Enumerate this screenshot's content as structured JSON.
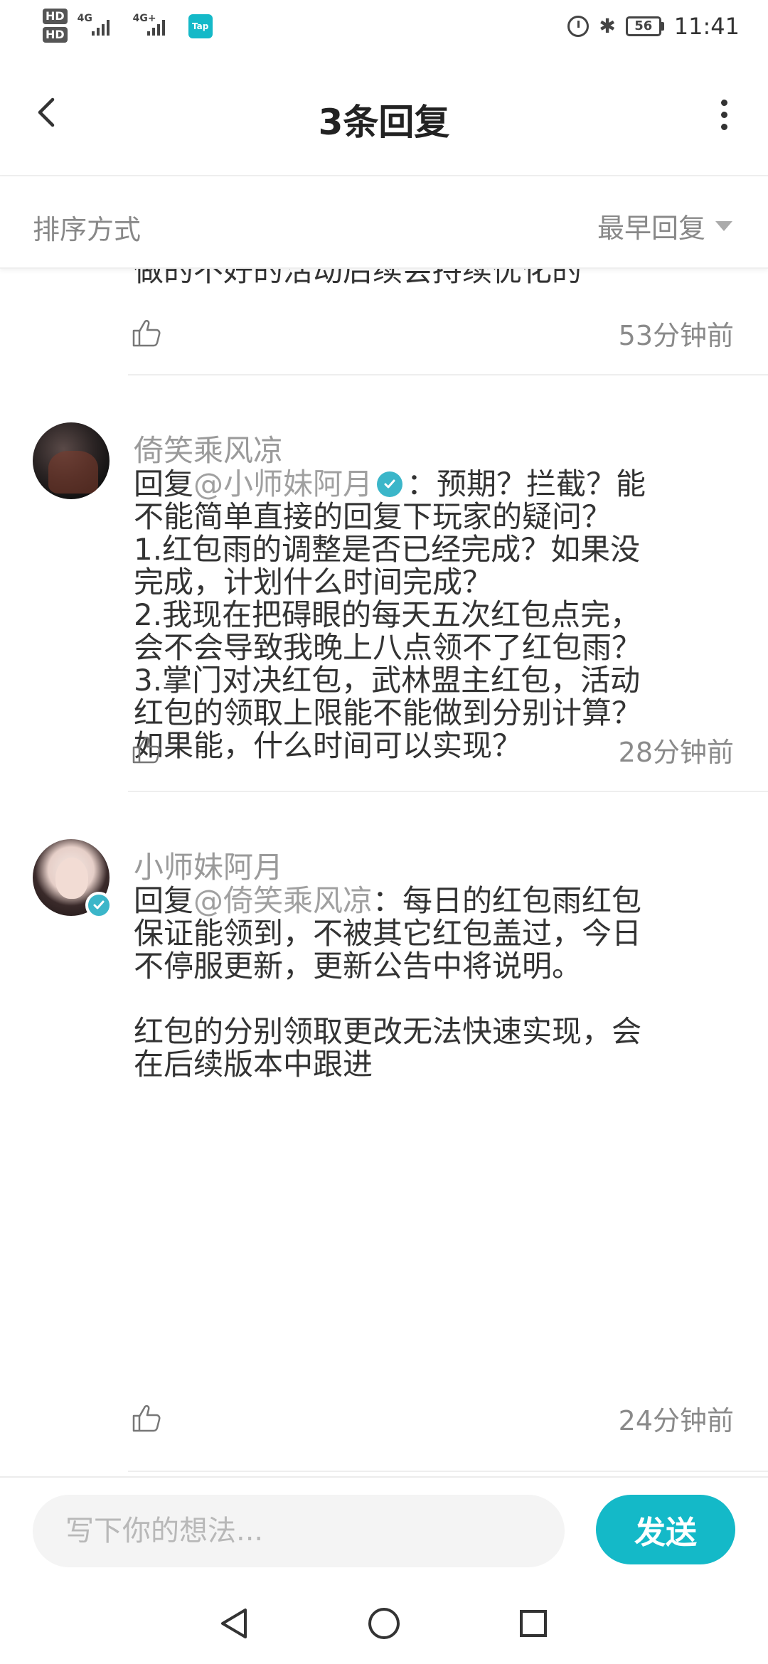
{
  "status_bar": {
    "hd1": "HD",
    "hd2": "HD",
    "net1": "4G",
    "net2": "4G+",
    "app_badge": "Tap",
    "battery": "56",
    "time": "11:41"
  },
  "header": {
    "title": "3条回复"
  },
  "sort": {
    "label": "排序方式",
    "value": "最早回复"
  },
  "partial_comment": {
    "text": "做的不好的活动后续会持续优化的",
    "time": "53分钟前"
  },
  "comments": [
    {
      "username": "倚笑乘风凉",
      "reply_prefix": "回复",
      "mention": "@小师妹阿月",
      "mention_verified": true,
      "lines": [
        "：预期？拦截？能",
        "不能简单直接的回复下玩家的疑问？",
        "1.红包雨的调整是否已经完成？如果没",
        "完成，计划什么时间完成？",
        "2.我现在把碍眼的每天五次红包点完，",
        "会不会导致我晚上八点领不了红包雨？",
        "3.掌门对决红包，武林盟主红包，活动",
        "红包的领取上限能不能做到分别计算？",
        "如果能，什么时间可以实现？"
      ],
      "time": "28分钟前"
    },
    {
      "username": "小师妹阿月",
      "verified": true,
      "reply_prefix": "回复",
      "mention": "@倚笑乘风凉",
      "lines": [
        "：每日的红包雨红包",
        "保证能领到，不被其它红包盖过，今日",
        "不停服更新，更新公告中将说明。",
        "",
        "红包的分别领取更改无法快速实现，会",
        "在后续版本中跟进"
      ],
      "time": "24分钟前"
    }
  ],
  "input": {
    "placeholder": "写下你的想法...",
    "send_label": "发送"
  },
  "colors": {
    "accent": "#14b9c8",
    "verified": "#3bb6c9",
    "muted": "#8a8a8a"
  }
}
